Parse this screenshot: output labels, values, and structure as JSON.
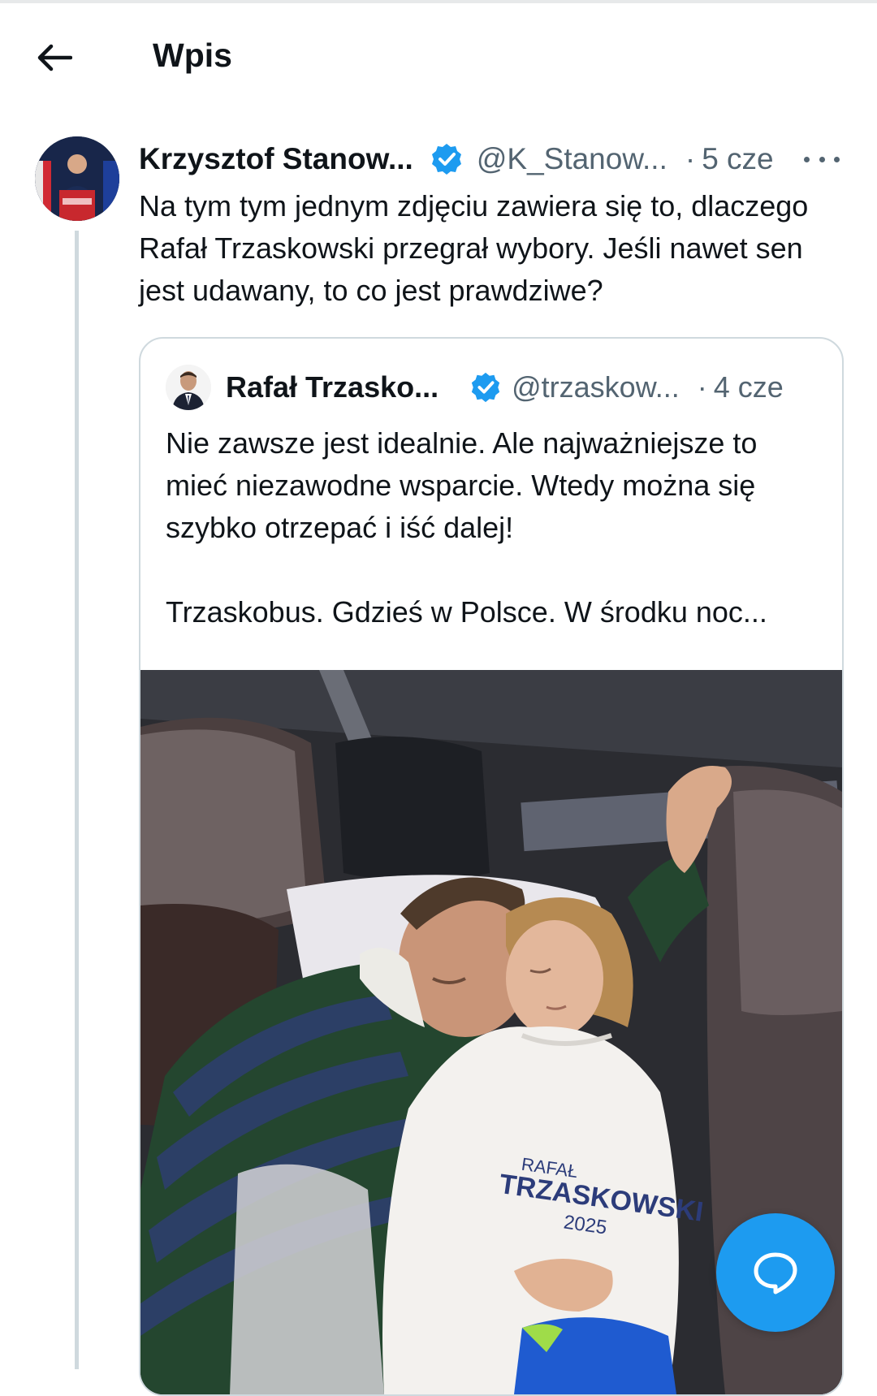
{
  "header": {
    "title": "Wpis"
  },
  "post": {
    "author_name": "Krzysztof Stanow...",
    "handle": "@K_Stanow...",
    "separator": "·",
    "time": "5 cze",
    "text": "Na tym tym jednym zdjęciu zawiera się to, dlaczego Rafał Trzaskowski przegrał wybory. Jeśli nawet sen jest udawany, to co jest prawdziwe?",
    "quoted": {
      "author_name": "Rafał Trzasko...",
      "handle": "@trzaskow...",
      "separator": "·",
      "time": "4 cze",
      "text_line1": "Nie zawsze jest idealnie. Ale najważniejsze to mieć niezawodne wsparcie. Wtedy można się szybko otrzepać i iść dalej!",
      "text_line2": "Trzaskobus. Gdzieś w Polsce. W środku noc...",
      "photo": {
        "hoodie_text_line1": "RAFAŁ",
        "hoodie_text_line2": "TRZASKOWSKI",
        "hoodie_text_line3": "2025"
      }
    }
  },
  "colors": {
    "accent": "#1d9bf0",
    "text": "#0f1419",
    "secondary_text": "#536471",
    "border": "#cfd9de"
  },
  "icons": {
    "back": "arrow-left-icon",
    "verified": "verified-badge-icon",
    "more": "more-dots-icon",
    "reply_fab": "reply-bubble-icon"
  }
}
